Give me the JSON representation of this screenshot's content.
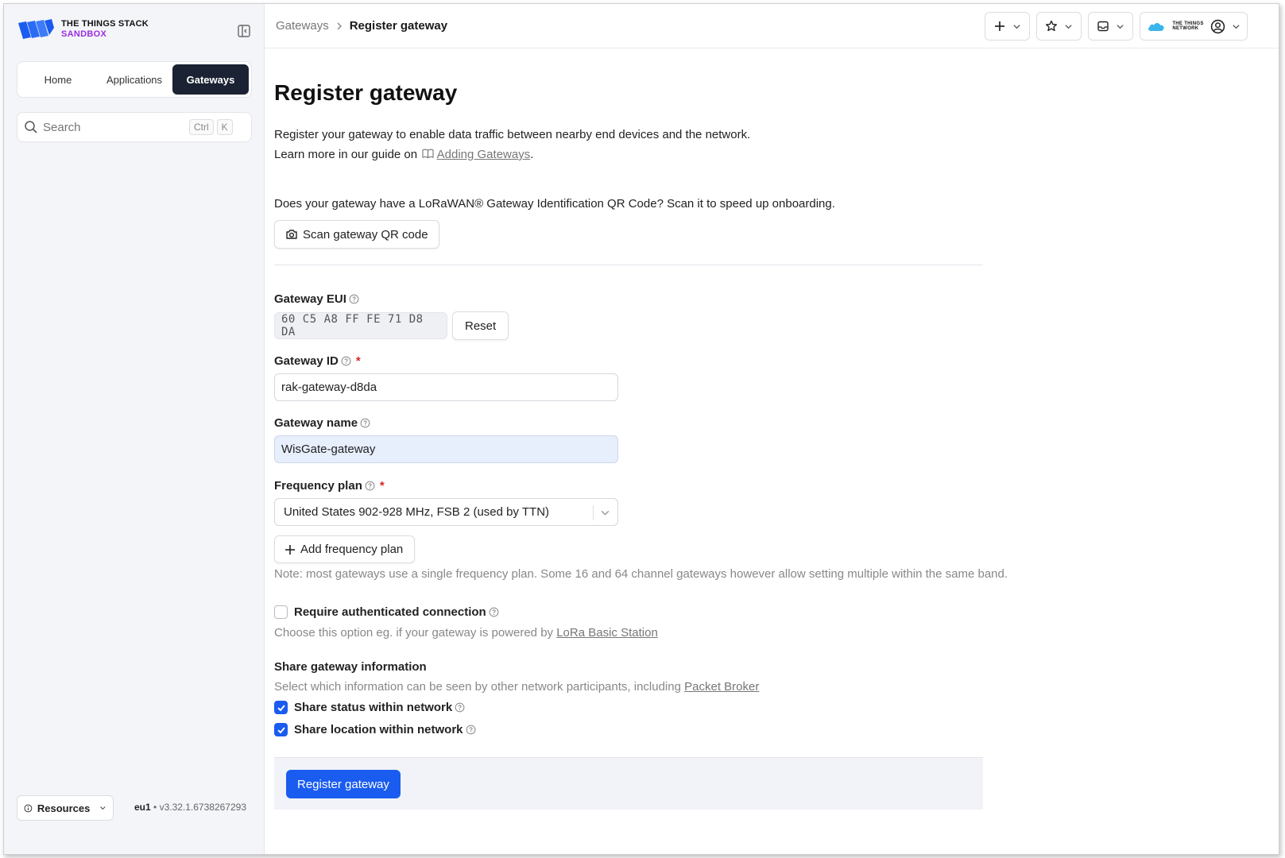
{
  "brand": {
    "line1": "THE THINGS STACK",
    "line2": "SANDBOX",
    "accent_color": "#9b2de0"
  },
  "sidebar": {
    "tabs": [
      {
        "label": "Home",
        "active": false
      },
      {
        "label": "Applications",
        "active": false
      },
      {
        "label": "Gateways",
        "active": true
      }
    ],
    "search": {
      "placeholder": "Search",
      "shortcut_1": "Ctrl",
      "shortcut_2": "K"
    },
    "resources_label": "Resources",
    "cluster": "eu1",
    "version": "v3.32.1.6738267293"
  },
  "topbar": {
    "breadcrumb": {
      "parent": "Gateways",
      "current": "Register gateway"
    },
    "buttons": [
      "plus-icon",
      "star-icon",
      "inbox-icon",
      "user-icon"
    ],
    "network_logo": {
      "line1": "THE THINGS",
      "line2": "NETWORK"
    }
  },
  "main": {
    "title": "Register gateway",
    "description_line1": "Register your gateway to enable data traffic between nearby end devices and the network.",
    "description_line2_prefix": "Learn more in our guide on",
    "description_link": "Adding Gateways",
    "description_line2_suffix": ".",
    "qr_question": "Does your gateway have a LoRaWAN® Gateway Identification QR Code? Scan it to speed up onboarding.",
    "qr_button": "Scan gateway QR code",
    "fields": {
      "eui": {
        "label": "Gateway EUI",
        "value": "60 C5 A8 FF FE 71 D8 DA",
        "reset_label": "Reset"
      },
      "id": {
        "label": "Gateway ID",
        "required_mark": "*",
        "value": "rak-gateway-d8da"
      },
      "name": {
        "label": "Gateway name",
        "value": "WisGate-gateway"
      },
      "frequency": {
        "label": "Frequency plan",
        "required_mark": "*",
        "value": "United States 902-928 MHz, FSB 2 (used by TTN)",
        "add_label": "Add frequency plan",
        "note": "Note: most gateways use a single frequency plan. Some 16 and 64 channel gateways however allow setting multiple within the same band."
      }
    },
    "auth": {
      "label": "Require authenticated connection",
      "checked": false,
      "hint_prefix": "Choose this option eg. if your gateway is powered by",
      "hint_link": "LoRa Basic Station"
    },
    "share": {
      "title": "Share gateway information",
      "hint_prefix": "Select which information can be seen by other network participants, including",
      "hint_link": "Packet Broker",
      "status_label": "Share status within network",
      "status_checked": true,
      "location_label": "Share location within network",
      "location_checked": true
    },
    "submit_label": "Register gateway",
    "primary_color": "#1a5cf0"
  }
}
